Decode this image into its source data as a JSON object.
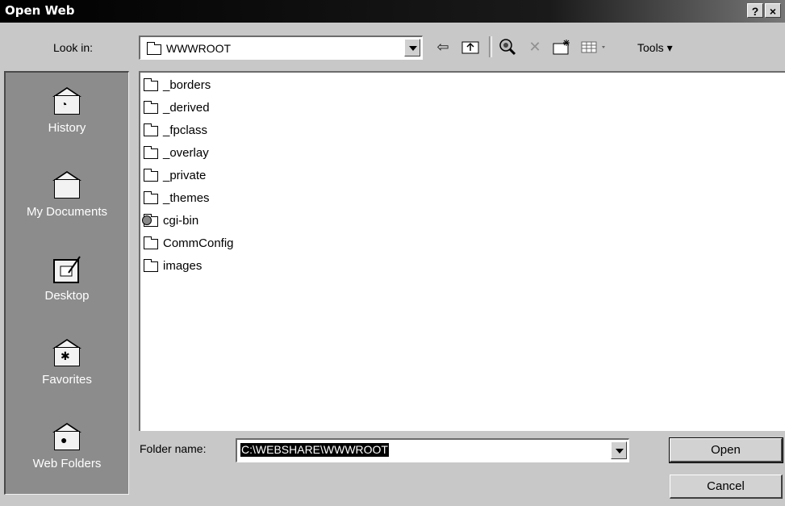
{
  "window": {
    "title": "Open Web",
    "help_label": "?",
    "close_label": "×"
  },
  "toolbar": {
    "look_in_label": "Look in:",
    "look_in_value": "WWWROOT",
    "tools_label": "Tools ▾",
    "icons": [
      "back-icon",
      "up-folder-icon",
      "search-web-icon",
      "delete-icon",
      "new-folder-icon",
      "views-icon"
    ]
  },
  "places": [
    {
      "label": "History",
      "icon": "history-icon"
    },
    {
      "label": "My Documents",
      "icon": "my-documents-icon"
    },
    {
      "label": "Desktop",
      "icon": "desktop-icon"
    },
    {
      "label": "Favorites",
      "icon": "favorites-icon"
    },
    {
      "label": "Web Folders",
      "icon": "web-folders-icon"
    }
  ],
  "files": [
    {
      "name": "_borders"
    },
    {
      "name": "_derived"
    },
    {
      "name": "_fpclass"
    },
    {
      "name": "_overlay"
    },
    {
      "name": "_private"
    },
    {
      "name": "_themes"
    },
    {
      "name": "cgi-bin",
      "special": true
    },
    {
      "name": "CommConfig"
    },
    {
      "name": "images"
    }
  ],
  "bottom": {
    "folder_name_label": "Folder name:",
    "folder_name_value": "C:\\WEBSHARE\\WWWROOT",
    "open_label": "Open",
    "cancel_label": "Cancel"
  }
}
